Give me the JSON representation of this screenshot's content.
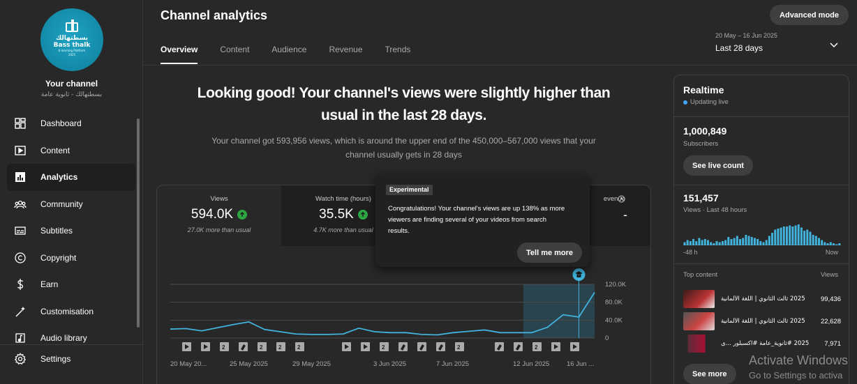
{
  "channel": {
    "avatar_brand": "Bass thalk",
    "avatar_arabic": "بسطتهالك",
    "avatar_tagline": "E-learning Platform",
    "avatar_year": "2025",
    "label": "Your channel",
    "name": "بسطتهالك - ثانوية عامة"
  },
  "sidebar": {
    "items": [
      {
        "label": "Dashboard",
        "icon": "dashboard-icon"
      },
      {
        "label": "Content",
        "icon": "content-icon"
      },
      {
        "label": "Analytics",
        "icon": "analytics-icon",
        "active": true
      },
      {
        "label": "Community",
        "icon": "community-icon"
      },
      {
        "label": "Subtitles",
        "icon": "subtitles-icon"
      },
      {
        "label": "Copyright",
        "icon": "copyright-icon"
      },
      {
        "label": "Earn",
        "icon": "earn-icon"
      },
      {
        "label": "Customisation",
        "icon": "customisation-icon"
      },
      {
        "label": "Audio library",
        "icon": "audio-library-icon"
      }
    ],
    "settings_label": "Settings"
  },
  "header": {
    "title": "Channel analytics",
    "advanced_mode": "Advanced mode",
    "tabs": [
      "Overview",
      "Content",
      "Audience",
      "Revenue",
      "Trends"
    ],
    "active_tab": "Overview",
    "date_range": "20 May – 16 Jun 2025",
    "date_label": "Last 28 days"
  },
  "summary": {
    "headline": "Looking good! Your channel's views were slightly higher than usual in the last 28 days.",
    "subtext": "Your channel got 593,956 views, which is around the upper end of the 450,000–567,000 views that your channel usually gets in 28 days"
  },
  "metrics": [
    {
      "label": "Views",
      "value": "594.0K",
      "note": "27.0K more than usual"
    },
    {
      "label": "Watch time (hours)",
      "value": "35.5K",
      "note": "4.7K more than usual"
    },
    {
      "label": "evenue",
      "value": "-"
    }
  ],
  "popup": {
    "badge": "Experimental",
    "text": "Congratulations! Your channel's views are up 138% as more viewers are finding several of your videos from search results.",
    "button": "Tell me more"
  },
  "chart_data": {
    "type": "line",
    "x_labels": [
      "20 May 20...",
      "25 May 2025",
      "29 May 2025",
      "3 Jun 2025",
      "7 Jun 2025",
      "12 Jun 2025",
      "16 Jun ..."
    ],
    "y_ticks": [
      "120.0K",
      "80.0K",
      "40.0K",
      "0"
    ],
    "ylim": [
      0,
      120000
    ],
    "x": [
      "20 May",
      "21 May",
      "22 May",
      "23 May",
      "24 May",
      "25 May",
      "26 May",
      "27 May",
      "28 May",
      "29 May",
      "30 May",
      "31 May",
      "1 Jun",
      "2 Jun",
      "3 Jun",
      "4 Jun",
      "5 Jun",
      "6 Jun",
      "7 Jun",
      "8 Jun",
      "9 Jun",
      "10 Jun",
      "11 Jun",
      "12 Jun",
      "13 Jun",
      "14 Jun",
      "15 Jun",
      "16 Jun"
    ],
    "values": [
      20000,
      21000,
      16000,
      23000,
      30000,
      36000,
      19000,
      14000,
      9000,
      8000,
      8000,
      9000,
      22000,
      14000,
      12000,
      12000,
      8000,
      7000,
      12000,
      15000,
      18000,
      12000,
      12000,
      12000,
      24000,
      52000,
      47000,
      102000
    ],
    "highlight_range": [
      "12 Jun",
      "16 Jun"
    ],
    "marker_rows": [
      [
        "play",
        "play",
        "2",
        "short",
        "2",
        "2",
        "2",
        "play",
        "play",
        "2",
        "short",
        "short",
        "short",
        "2",
        "short",
        "short",
        "2",
        "play",
        "play",
        "2",
        "2",
        "short"
      ]
    ],
    "grid": true
  },
  "realtime": {
    "title": "Realtime",
    "live": "Updating live",
    "subscribers": "1,000,849",
    "subscribers_label": "Subscribers",
    "see_live": "See live count",
    "views": "151,457",
    "views_label": "Views · Last 48 hours",
    "axis_left": "-48 h",
    "axis_right": "Now",
    "hourly_values": [
      3,
      5,
      4,
      6,
      4,
      7,
      5,
      6,
      5,
      3,
      2,
      4,
      3,
      4,
      5,
      8,
      6,
      7,
      9,
      6,
      7,
      10,
      9,
      8,
      7,
      6,
      4,
      3,
      5,
      9,
      12,
      15,
      16,
      17,
      18,
      18,
      19,
      18,
      19,
      20,
      17,
      14,
      15,
      13,
      10,
      9,
      7,
      5,
      3,
      2,
      3,
      2,
      1,
      2
    ],
    "top_content_label": "Top content",
    "views_header": "Views",
    "top_content": [
      {
        "title": "2025 ثالث الثانوي | اللغة الألمانية",
        "views": "99,436",
        "thumb": "#7a2b2b"
      },
      {
        "title": "2025 ثالث الثانوي | اللغة الألمانية",
        "views": "22,628",
        "thumb": "#8a3a36"
      },
      {
        "title": "2025 #ثانوية_عامة #اكسبلور ...ى",
        "views": "7,971",
        "thumb": "#5a2b3a"
      }
    ],
    "see_more": "See more"
  },
  "watermark": {
    "line1": "Activate Windows",
    "line2": "Go to Settings to activa"
  },
  "colors": {
    "accent": "#3ea6ff",
    "up": "#2ba640",
    "line": "#41b3dc"
  }
}
